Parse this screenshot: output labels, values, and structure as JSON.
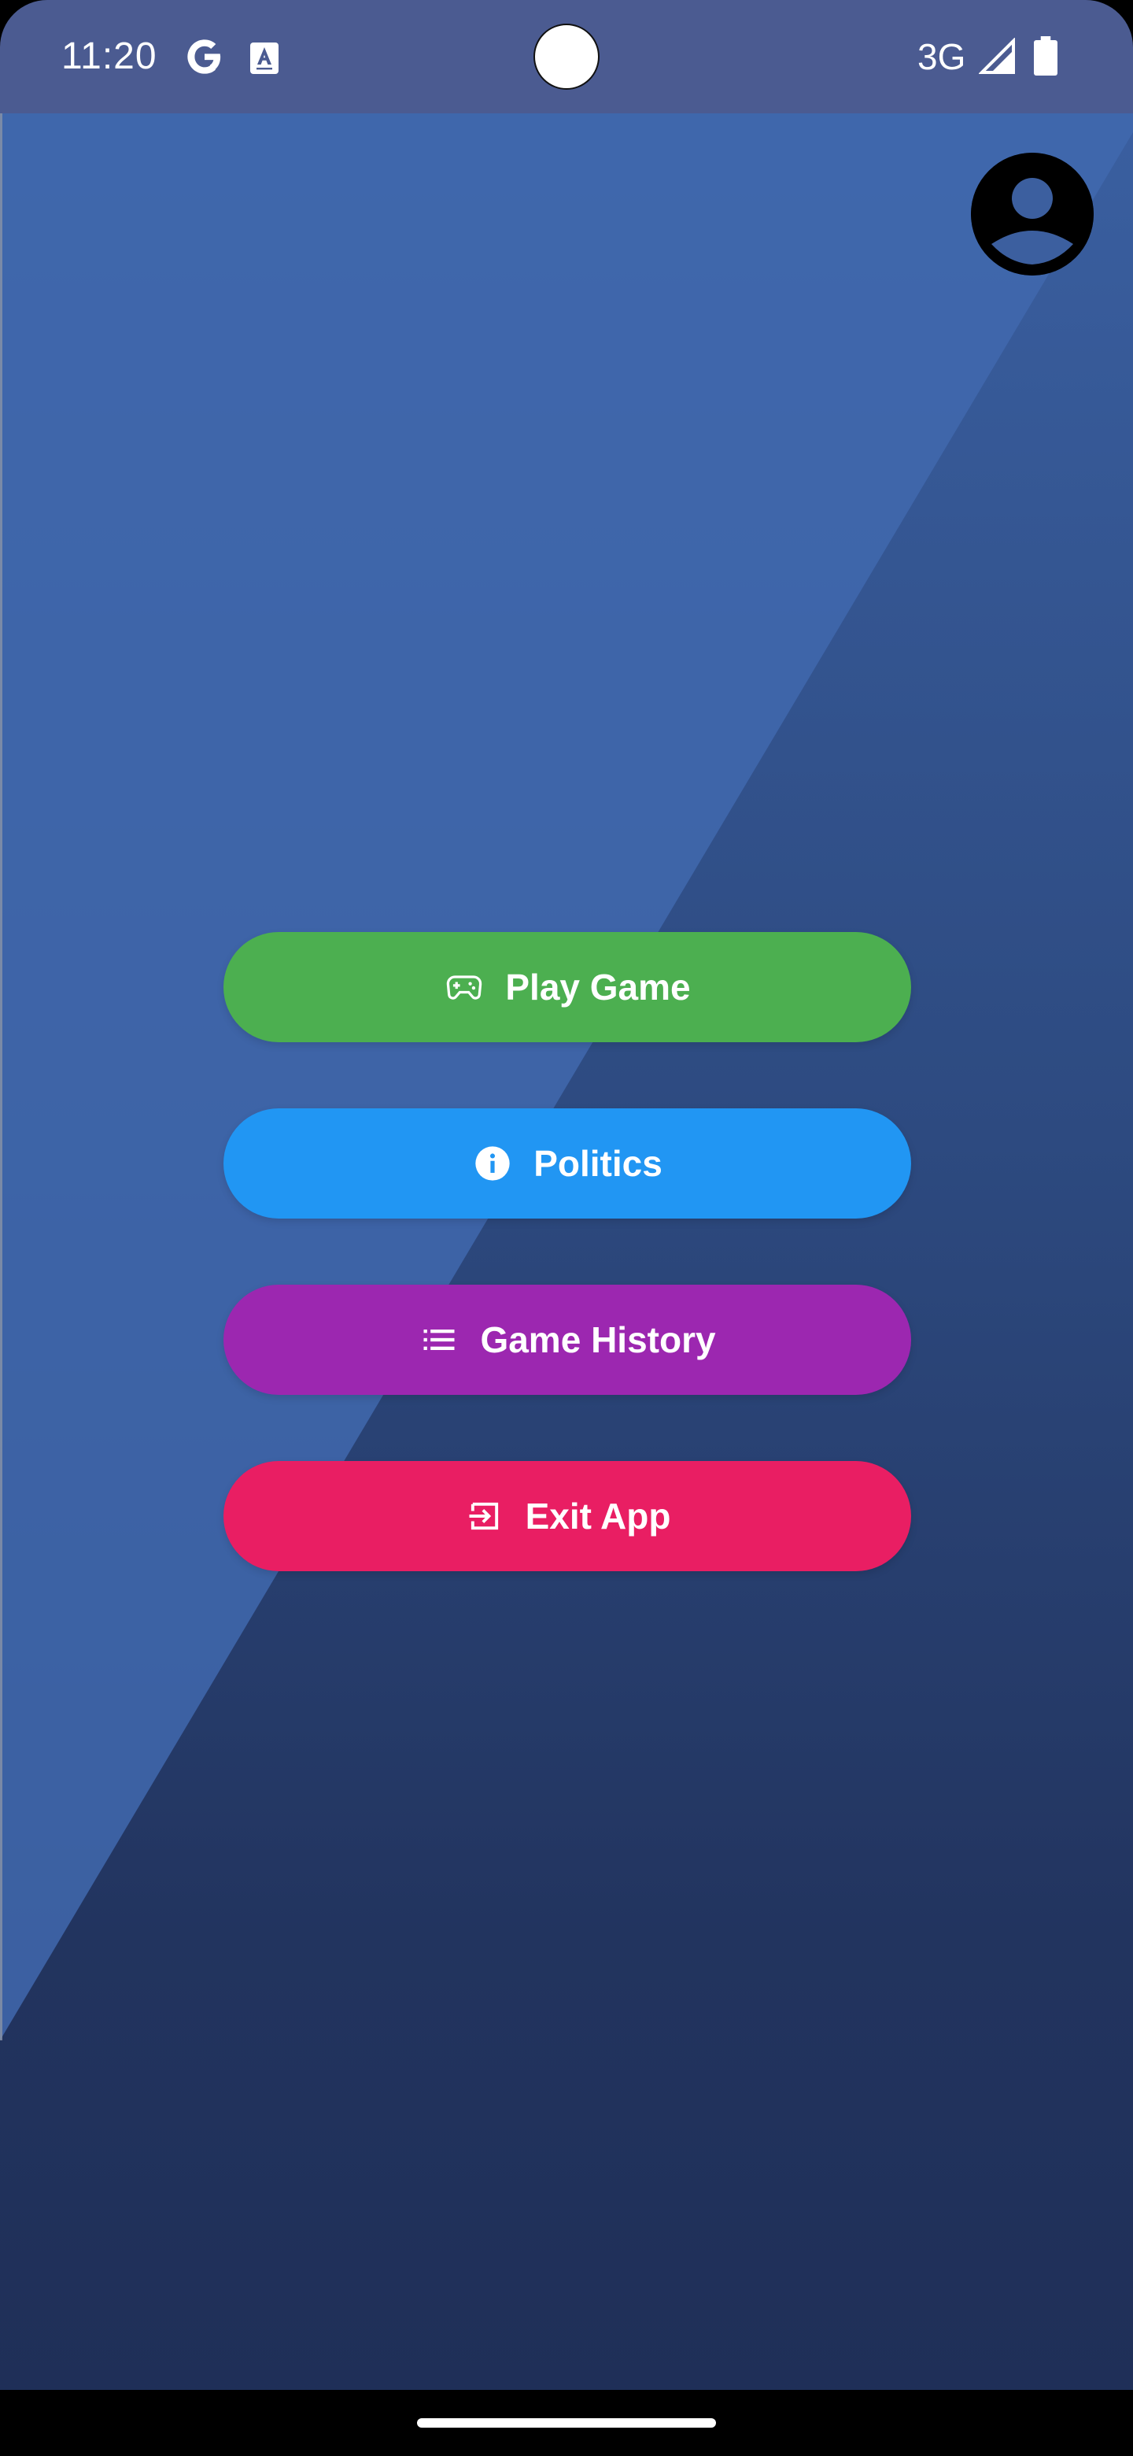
{
  "status_bar": {
    "time": "11:20",
    "network": "3G",
    "icons": [
      "google-g-icon",
      "accessibility-a-icon",
      "signal-icon",
      "battery-icon"
    ]
  },
  "menu": {
    "play": {
      "label": "Play Game",
      "icon": "gamepad-icon",
      "color": "#4caf50"
    },
    "politics": {
      "label": "Politics",
      "icon": "info-icon",
      "color": "#2196f3"
    },
    "history": {
      "label": "Game History",
      "icon": "list-icon",
      "color": "#9c27b0"
    },
    "exit": {
      "label": "Exit App",
      "icon": "exit-icon",
      "color": "#e91e63"
    }
  },
  "profile": {
    "icon": "account-circle-icon"
  },
  "colors": {
    "status_bar": "#4b5b91",
    "background_top": "#3a5fa0",
    "background_bottom": "#1f2f58"
  }
}
